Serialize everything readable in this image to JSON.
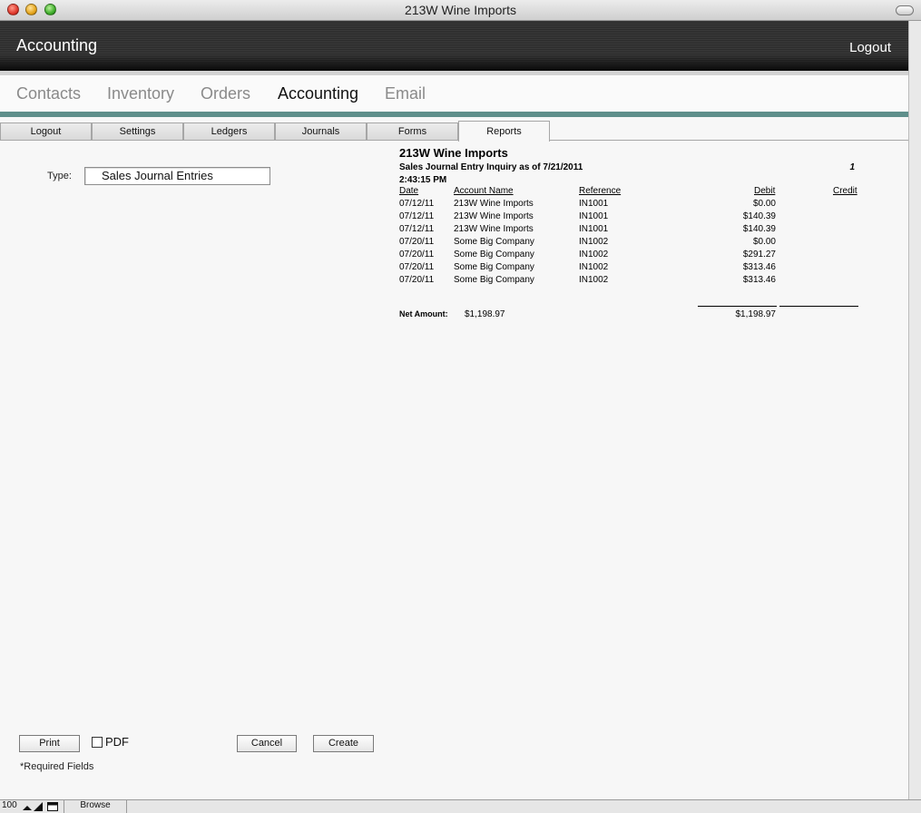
{
  "window": {
    "title": "213W Wine Imports"
  },
  "header": {
    "title": "Accounting",
    "logout": "Logout"
  },
  "modules": [
    "Contacts",
    "Inventory",
    "Orders",
    "Accounting",
    "Email"
  ],
  "active_module": "Accounting",
  "tabs": [
    "Logout",
    "Settings",
    "Ledgers",
    "Journals",
    "Forms",
    "Reports"
  ],
  "active_tab": "Reports",
  "type_field": {
    "label": "Type:",
    "value": "Sales Journal Entries"
  },
  "report": {
    "company": "213W Wine Imports",
    "subtitle": "Sales Journal Entry Inquiry as of 7/21/2011",
    "time": "2:43:15 PM",
    "page": "1",
    "columns": {
      "date": "Date",
      "account": "Account Name",
      "reference": "Reference",
      "debit": "Debit",
      "credit": "Credit"
    },
    "rows": [
      {
        "date": "07/12/11",
        "account": "213W Wine Imports",
        "reference": "IN1001",
        "debit": "$0.00"
      },
      {
        "date": "07/12/11",
        "account": "213W Wine Imports",
        "reference": "IN1001",
        "debit": "$140.39"
      },
      {
        "date": "07/12/11",
        "account": "213W Wine Imports",
        "reference": "IN1001",
        "debit": "$140.39"
      },
      {
        "date": "07/20/11",
        "account": "Some Big Company",
        "reference": "IN1002",
        "debit": "$0.00"
      },
      {
        "date": "07/20/11",
        "account": "Some Big Company",
        "reference": "IN1002",
        "debit": "$291.27"
      },
      {
        "date": "07/20/11",
        "account": "Some Big Company",
        "reference": "IN1002",
        "debit": "$313.46"
      },
      {
        "date": "07/20/11",
        "account": "Some Big Company",
        "reference": "IN1002",
        "debit": "$313.46"
      }
    ],
    "net_label": "Net Amount:",
    "net_amount": "$1,198.97",
    "net_debit": "$1,198.97"
  },
  "buttons": {
    "print": "Print",
    "pdf": "PDF",
    "cancel": "Cancel",
    "create": "Create"
  },
  "required_note": "*Required Fields",
  "statusbar": {
    "zoom": "100",
    "mode": "Browse"
  }
}
